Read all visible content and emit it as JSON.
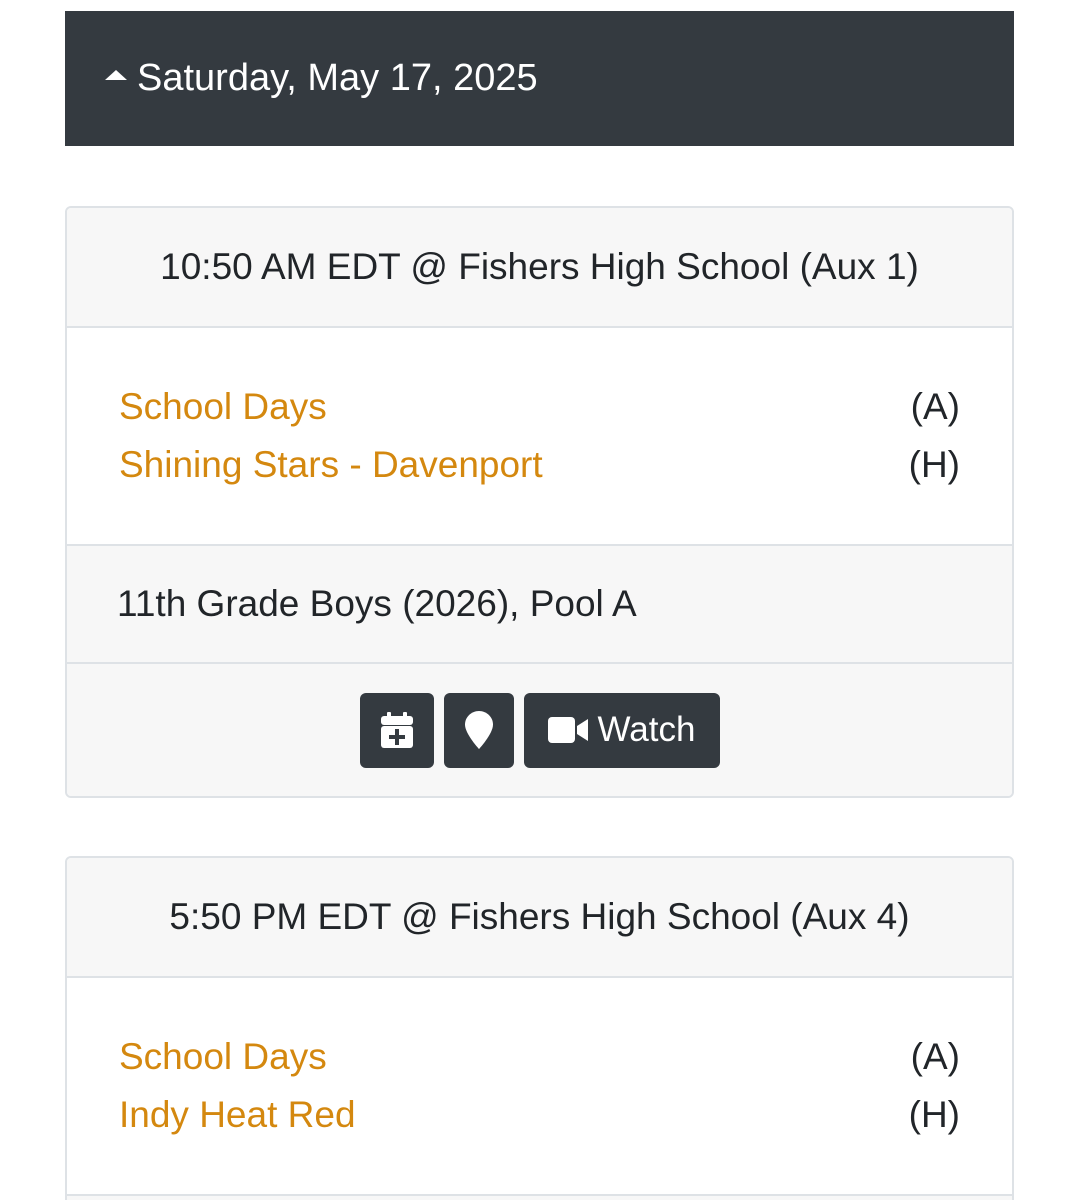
{
  "date_header": {
    "label": "Saturday, May 17, 2025",
    "icon": "caret-up-icon"
  },
  "games": [
    {
      "time_location": "10:50 AM EDT @ Fishers High School (Aux 1)",
      "teams": [
        {
          "name": "School Days",
          "side": "(A)"
        },
        {
          "name": "Shining Stars - Davenport",
          "side": "(H)"
        }
      ],
      "division": "11th Grade Boys (2026), Pool A",
      "actions": {
        "calendar_icon": "calendar-plus-icon",
        "map_icon": "map-marker-icon",
        "watch_label": "Watch",
        "watch_icon": "video-camera-icon"
      }
    },
    {
      "time_location": "5:50 PM EDT @ Fishers High School (Aux 4)",
      "teams": [
        {
          "name": "School Days",
          "side": "(A)"
        },
        {
          "name": "Indy Heat Red",
          "side": "(H)"
        }
      ]
    }
  ],
  "colors": {
    "header_bg": "#343a40",
    "team_link": "#d4880f",
    "card_bg": "#f7f7f7",
    "border": "#dee2e6"
  }
}
